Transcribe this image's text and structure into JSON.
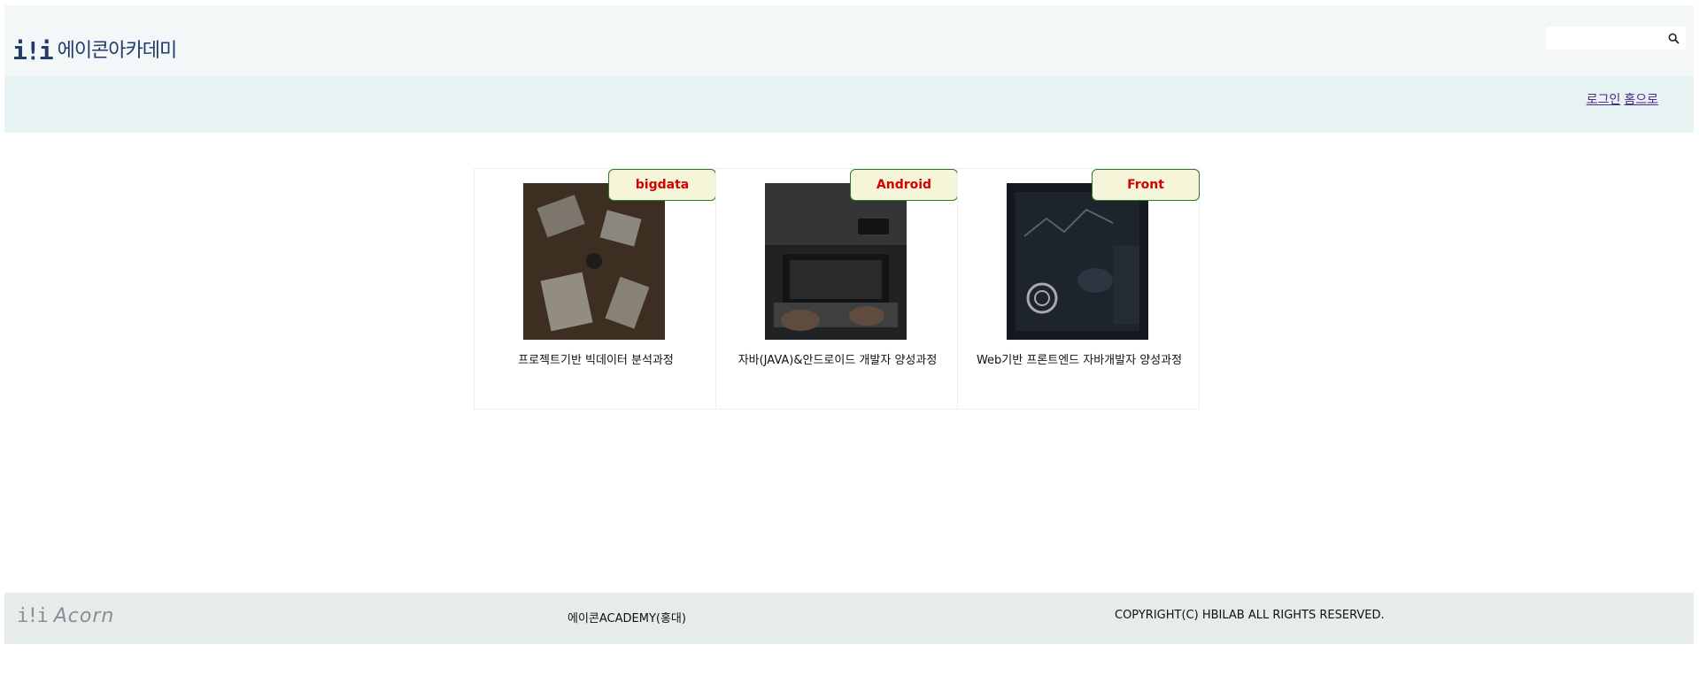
{
  "header": {
    "logo_mark": "i!i",
    "logo_text": "에이콘아카데미",
    "search": {
      "placeholder": "",
      "value": ""
    }
  },
  "nav": {
    "links": [
      "로그인",
      "홈으로"
    ]
  },
  "courses": [
    {
      "badge": "bigdata",
      "title": "프로젝트기반 빅데이터 분석과정",
      "image": "business-meeting-photo"
    },
    {
      "badge": "Android",
      "title": "자바(JAVA)&안드로이드 개발자 양성과정",
      "image": "laptop-typing-photo"
    },
    {
      "badge": "Front",
      "title": "Web기반 프론트엔드 자바개발자 양성과정",
      "image": "tech-dashboard-photo"
    }
  ],
  "footer": {
    "logo_mark": "i!i",
    "logo_text": "Acorn",
    "name": "에이콘ACADEMY(홍대)",
    "copyright": "COPYRIGHT(C) HBILAB ALL RIGHTS RESERVED."
  },
  "colors": {
    "brand": "#1f3d6b",
    "badge_text": "#d60000",
    "badge_bg": "#f5f5d9",
    "badge_border": "#2c7a2c"
  }
}
